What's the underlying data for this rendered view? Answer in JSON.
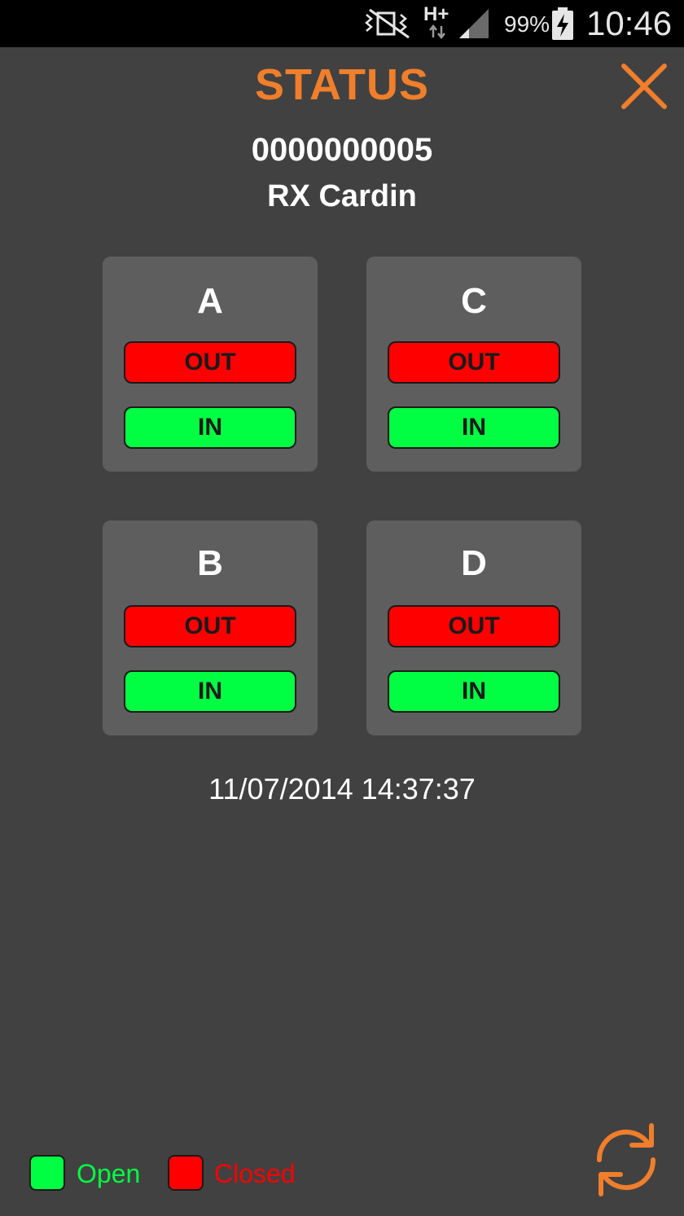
{
  "status_bar": {
    "battery": "99%",
    "time": "10:46",
    "network": "H+"
  },
  "header": {
    "title": "STATUS",
    "device_id": "0000000005",
    "device_name": "RX Cardin"
  },
  "channels": [
    {
      "label": "A",
      "out_label": "OUT",
      "in_label": "IN"
    },
    {
      "label": "C",
      "out_label": "OUT",
      "in_label": "IN"
    },
    {
      "label": "B",
      "out_label": "OUT",
      "in_label": "IN"
    },
    {
      "label": "D",
      "out_label": "OUT",
      "in_label": "IN"
    }
  ],
  "timestamp": "11/07/2014 14:37:37",
  "legend": {
    "open_label": "Open",
    "closed_label": "Closed",
    "open_color": "#00ff43",
    "closed_color": "#ff0000"
  },
  "colors": {
    "accent": "#f07e2b",
    "background": "#414141",
    "card": "#5e5e5e"
  }
}
